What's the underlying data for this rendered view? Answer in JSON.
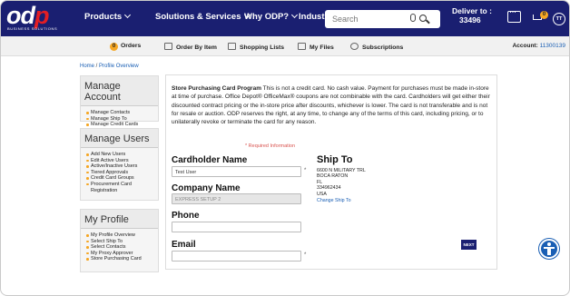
{
  "header": {
    "logo_text": "odp",
    "logo_sub": "BUSINESS SOLUTIONS",
    "nav": [
      "Products",
      "Solutions & Services",
      "Why ODP?",
      "Industries"
    ],
    "search_placeholder": "Search",
    "deliver_label": "Deliver to :",
    "deliver_zip": "33496",
    "cart_count": "0",
    "avatar_initials": "TT"
  },
  "subnav": {
    "orders_count": "0",
    "orders": "Orders",
    "order_by_item": "Order By Item",
    "shopping_lists": "Shopping Lists",
    "my_files": "My Files",
    "subscriptions": "Subscriptions",
    "account_label": "Account:",
    "account_number": "11300139"
  },
  "breadcrumb": {
    "home": "Home",
    "sep": " / ",
    "current": "Profile Overview"
  },
  "sidebar": {
    "manage_account": {
      "title": "Manage Account",
      "items": [
        "Manage Contacts",
        "Manage Ship To",
        "Manage Credit Cards"
      ]
    },
    "manage_users": {
      "title": "Manage Users",
      "items": [
        "Add New Users",
        "Edit Active Users",
        "Active/Inactive Users",
        "Tiered Approvals",
        "Credit Card Groups",
        "Procurement Card Registration"
      ]
    },
    "my_profile": {
      "title": "My Profile",
      "items": [
        "My Profile Overview",
        "Select Ship To",
        "Select Contacts",
        "My Proxy Approver",
        "Store Purchasing Card"
      ]
    }
  },
  "main": {
    "notice_title": "Store Purchasing Card Program",
    "notice_body": " This is not a credit card. No cash value. Payment for purchases must be made in-store at time of purchase. Office Depot® OfficeMax® coupons are not combinable with the card. Cardholders will get either their discounted contract pricing or the in-store price after discounts, whichever is lower. The card is not transferable and is not for resale or auction. ODP reserves the right, at any time, to change any of the terms of this card, including pricing, or to unilaterally revoke or terminate the card for any reason.",
    "required_note": "* Required Information",
    "cardholder_label": "Cardholder Name",
    "cardholder_value": "Test User",
    "company_label": "Company Name",
    "company_value": "EXPRESS SETUP 2",
    "phone_label": "Phone",
    "phone_value": "",
    "email_label": "Email",
    "email_value": "",
    "asterisk": "*",
    "ship_to": {
      "title": "Ship To",
      "lines": [
        "6600 N MILITARY TRL",
        "BOCA RATON",
        "FL",
        "334962434",
        "USA"
      ],
      "change_link": "Change Ship To"
    },
    "next_button": "NEXT"
  }
}
